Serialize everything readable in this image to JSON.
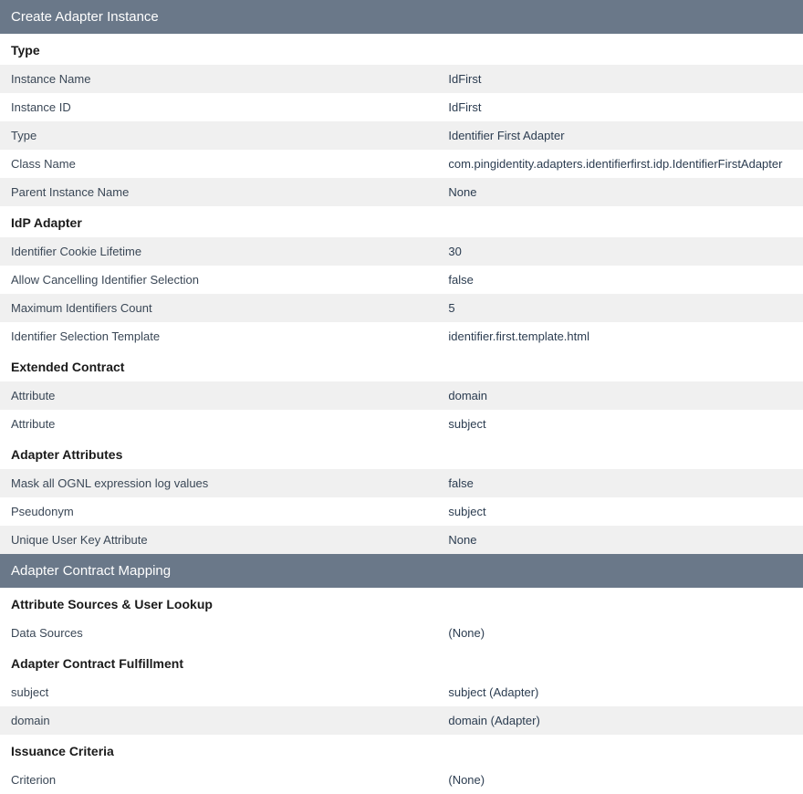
{
  "headers": {
    "create_adapter_instance": "Create Adapter Instance",
    "adapter_contract_mapping": "Adapter Contract Mapping"
  },
  "sections": {
    "type": {
      "heading": "Type",
      "rows": [
        {
          "label": "Instance Name",
          "value": "IdFirst"
        },
        {
          "label": "Instance ID",
          "value": "IdFirst"
        },
        {
          "label": "Type",
          "value": "Identifier First Adapter"
        },
        {
          "label": "Class Name",
          "value": "com.pingidentity.adapters.identifierfirst.idp.IdentifierFirstAdapter"
        },
        {
          "label": "Parent Instance Name",
          "value": "None"
        }
      ]
    },
    "idp_adapter": {
      "heading": "IdP Adapter",
      "rows": [
        {
          "label": "Identifier Cookie Lifetime",
          "value": "30"
        },
        {
          "label": "Allow Cancelling Identifier Selection",
          "value": "false"
        },
        {
          "label": "Maximum Identifiers Count",
          "value": "5"
        },
        {
          "label": "Identifier Selection Template",
          "value": "identifier.first.template.html"
        }
      ]
    },
    "extended_contract": {
      "heading": "Extended Contract",
      "rows": [
        {
          "label": "Attribute",
          "value": "domain"
        },
        {
          "label": "Attribute",
          "value": "subject"
        }
      ]
    },
    "adapter_attributes": {
      "heading": "Adapter Attributes",
      "rows": [
        {
          "label": "Mask all OGNL expression log values",
          "value": "false"
        },
        {
          "label": "Pseudonym",
          "value": "subject"
        },
        {
          "label": "Unique User Key Attribute",
          "value": "None"
        }
      ]
    },
    "attribute_sources": {
      "heading": "Attribute Sources & User Lookup",
      "rows": [
        {
          "label": "Data Sources",
          "value": "(None)"
        }
      ]
    },
    "adapter_contract_fulfillment": {
      "heading": "Adapter Contract Fulfillment",
      "rows": [
        {
          "label": "subject",
          "value": "subject (Adapter)"
        },
        {
          "label": "domain",
          "value": "domain (Adapter)"
        }
      ]
    },
    "issuance_criteria": {
      "heading": "Issuance Criteria",
      "rows": [
        {
          "label": "Criterion",
          "value": "(None)"
        }
      ]
    }
  }
}
